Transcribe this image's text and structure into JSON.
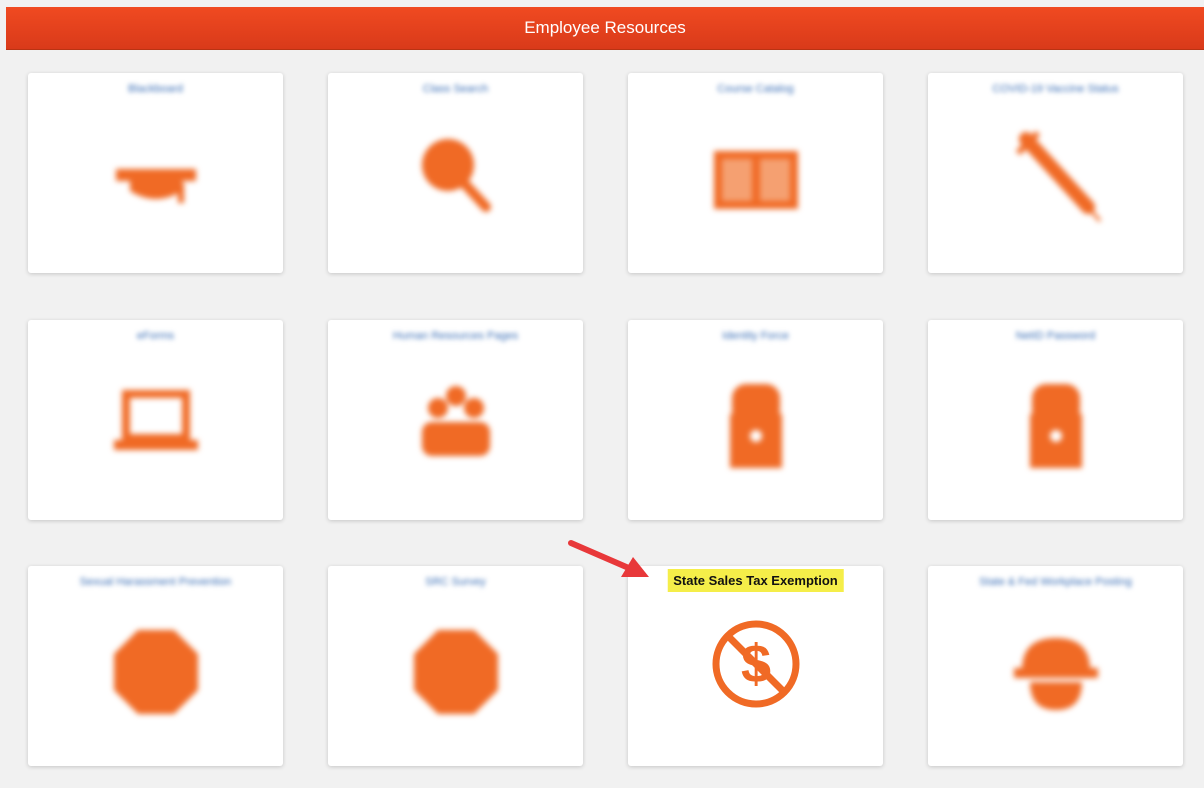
{
  "header": {
    "title": "Employee Resources"
  },
  "tiles": [
    {
      "label": "Blackboard",
      "icon": "graduation-cap-icon"
    },
    {
      "label": "Class Search",
      "icon": "magnifier-icon"
    },
    {
      "label": "Course Catalog",
      "icon": "open-book-icon"
    },
    {
      "label": "COVID-19 Vaccine Status",
      "icon": "syringe-icon"
    },
    {
      "label": "eForms",
      "icon": "laptop-icon"
    },
    {
      "label": "Human Resources Pages",
      "icon": "people-group-icon"
    },
    {
      "label": "Identity Force",
      "icon": "lock-icon"
    },
    {
      "label": "NetID Password",
      "icon": "lock-icon"
    },
    {
      "label": "Sexual Harassment Prevention",
      "icon": "stop-sign-icon"
    },
    {
      "label": "SRC Survey",
      "icon": "stop-sign-icon"
    },
    {
      "label": "State Sales Tax Exemption",
      "icon": "no-dollar-icon"
    },
    {
      "label": "State & Fed Workplace Posting",
      "icon": "hardhat-worker-icon"
    }
  ],
  "colors": {
    "accent": "#f06a25",
    "header": "#e8431d",
    "highlight": "#f5ee49",
    "arrow": "#e8383a"
  }
}
